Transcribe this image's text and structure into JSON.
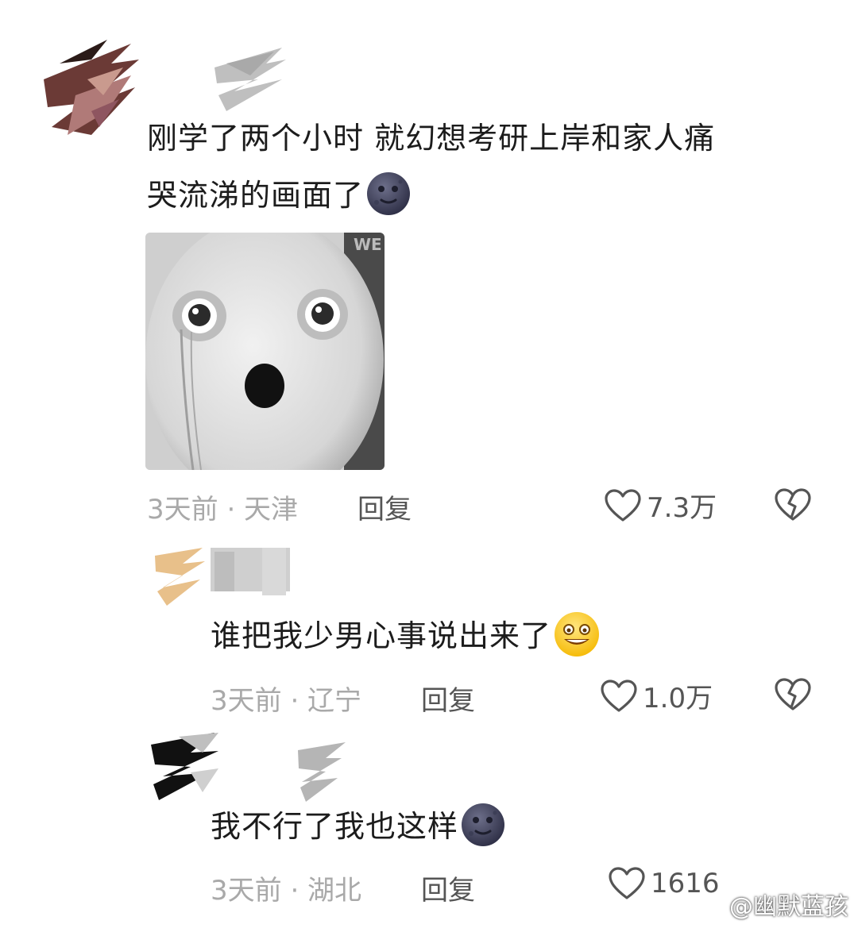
{
  "comments": [
    {
      "text_line1": "刚学了两个小时 就幻想考研上岸和家人痛",
      "text_line2": "哭流涕的画面了",
      "emoji": "moon-face-icon",
      "meta": "3天前 · 天津",
      "reply_label": "回复",
      "likes": "7.3万"
    },
    {
      "text": "谁把我少男心事说出来了",
      "emoji": "grinning-face-icon",
      "meta": "3天前 · 辽宁",
      "reply_label": "回复",
      "likes": "1.0万"
    },
    {
      "text": "我不行了我也这样",
      "emoji": "moon-face-icon",
      "meta": "3天前 · 湖北",
      "reply_label": "回复",
      "likes": "1616"
    }
  ],
  "watermark": "@幽默蓝孩"
}
